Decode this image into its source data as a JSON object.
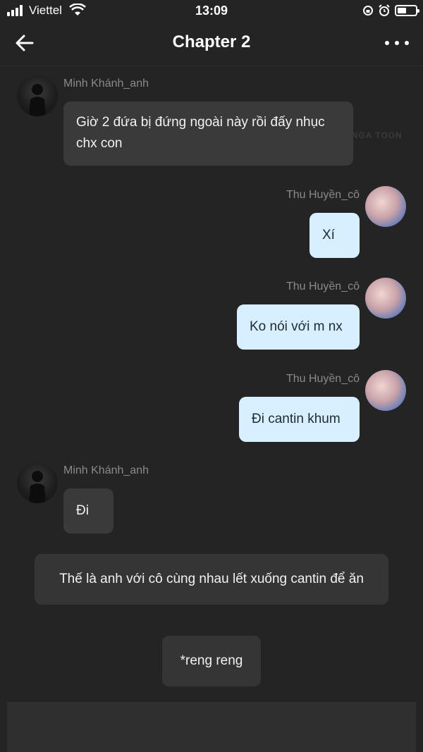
{
  "status_bar": {
    "carrier": "Viettel",
    "time": "13:09",
    "battery_level": 0.5
  },
  "header": {
    "title": "Chapter 2"
  },
  "watermark": "MANGA TOON",
  "messages": [
    {
      "sender": "Minh Khánh_anh",
      "side": "left",
      "text": "Giờ 2 đứa bị đứng ngoài này rồi đấy nhục chx con"
    },
    {
      "sender": "Thu Huyền_cô",
      "side": "right",
      "text": "Xí"
    },
    {
      "sender": "Thu Huyền_cô",
      "side": "right",
      "text": "Ko nói với m nx"
    },
    {
      "sender": "Thu Huyền_cô",
      "side": "right",
      "text": "Đi cantin khum"
    },
    {
      "sender": "Minh Khánh_anh",
      "side": "left",
      "text": "Đi"
    }
  ],
  "narration": [
    {
      "text": "Thế là anh với cô cùng nhau lết xuống cantin để ăn"
    },
    {
      "text": "*reng reng"
    }
  ]
}
